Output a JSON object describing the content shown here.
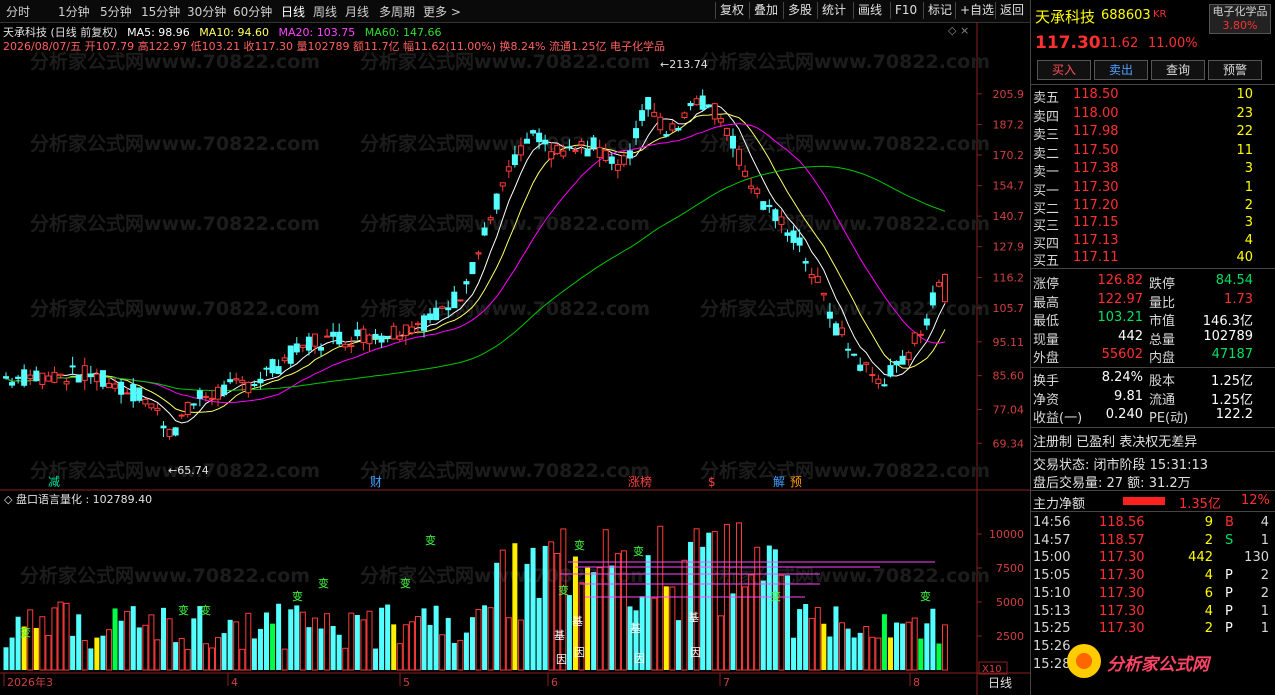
{
  "menu": {
    "periods": [
      "分时",
      "1分钟",
      "5分钟",
      "15分钟",
      "30分钟",
      "60分钟",
      "日线",
      "周线",
      "月线",
      "多周期",
      "更多 >"
    ],
    "tools": [
      "复权",
      "叠加",
      "多股",
      "统计",
      "画线",
      "F10",
      "标记",
      "+自选",
      "返回"
    ]
  },
  "chart_header": {
    "title": "天承科技 (日线 前复权)",
    "ma5": "MA5: 98.96",
    "ma10": "MA10: 94.60",
    "ma20": "MA20: 103.75",
    "ma60": "MA60: 147.66",
    "ohlc": "2026/08/07/五 开107.79 高122.97 低103.21 收117.30 量102789 额11.7亿 幅11.62(11.00%) 换8.24% 流通1.25亿 电子化学品"
  },
  "chart_data": {
    "type": "candlestick",
    "price_axis_ticks": [
      "205.9",
      "187.2",
      "170.2",
      "154.7",
      "140.7",
      "127.9",
      "116.2",
      "105.7",
      "95.11",
      "85.60",
      "77.04",
      "69.34"
    ],
    "volume_axis_ticks": [
      "10000",
      "7500",
      "5000",
      "2500"
    ],
    "volume_unit": "X10",
    "month_labels": [
      "2026年3",
      "4",
      "5",
      "6",
      "7",
      "8"
    ],
    "period_label": "日线",
    "high_label": "213.74",
    "low_label": "65.74",
    "events": [
      "减",
      "财",
      "涨榜",
      "$",
      "解",
      "预"
    ],
    "volume_indicator": "盘口语言量化 : 102789.40",
    "volume_marks": [
      "变",
      "基",
      "因"
    ],
    "watermark": "分析家公式网www.70822.com",
    "ylim": [
      65,
      215
    ],
    "vol_ylim": [
      0,
      12500
    ]
  },
  "colors": {
    "up": "#ff3b3b",
    "down": "#54ffff",
    "ma5": "#ffffff",
    "ma10": "#ffff66",
    "ma20": "#ff00ff",
    "ma60": "#00c800"
  },
  "quote": {
    "name": "天承科技",
    "code": "688603",
    "market": "KR",
    "sector": "电子化学品",
    "price": "117.30",
    "change": "11.62",
    "pct": "11.00%",
    "sector_pct": "3.80%",
    "buttons": [
      "买入",
      "卖出",
      "查询",
      "预警"
    ],
    "asks": [
      {
        "label": "卖五",
        "price": "118.50",
        "vol": "10"
      },
      {
        "label": "卖四",
        "price": "118.00",
        "vol": "23"
      },
      {
        "label": "卖三",
        "price": "117.98",
        "vol": "22"
      },
      {
        "label": "卖二",
        "price": "117.50",
        "vol": "11"
      },
      {
        "label": "卖一",
        "price": "117.38",
        "vol": "3"
      }
    ],
    "bids": [
      {
        "label": "买一",
        "price": "117.30",
        "vol": "1"
      },
      {
        "label": "买二",
        "price": "117.20",
        "vol": "2"
      },
      {
        "label": "买三",
        "price": "117.15",
        "vol": "3"
      },
      {
        "label": "买四",
        "price": "117.13",
        "vol": "4"
      },
      {
        "label": "买五",
        "price": "117.11",
        "vol": "40"
      }
    ],
    "stats": [
      {
        "l1": "涨停",
        "v1": "126.82",
        "l2": "跌停",
        "v2": "84.54"
      },
      {
        "l1": "最高",
        "v1": "122.97",
        "l2": "量比",
        "v2": "1.73"
      },
      {
        "l1": "最低",
        "v1": "103.21",
        "l2": "市值",
        "v2": "146.3亿"
      },
      {
        "l1": "现量",
        "v1": "442",
        "l2": "总量",
        "v2": "102789"
      },
      {
        "l1": "外盘",
        "v1": "55602",
        "l2": "内盘",
        "v2": "47187"
      }
    ],
    "fin": [
      {
        "l1": "换手",
        "v1": "8.24%",
        "l2": "股本",
        "v2": "1.25亿"
      },
      {
        "l1": "净资",
        "v1": "9.81",
        "l2": "流通",
        "v2": "1.25亿"
      },
      {
        "l1": "收益(一)",
        "v1": "0.240",
        "l2": "PE(动)",
        "v2": "122.2"
      }
    ],
    "note": "注册制 已盈利 表决权无差异",
    "status": "交易状态: 闭市阶段 15:31:13",
    "after": "盘后交易量: 27  额: 31.2万",
    "netflow_label": "主力净额",
    "netflow": "1.35亿",
    "netflow_pct": "12%",
    "ticks": [
      {
        "t": "14:56",
        "p": "118.56",
        "v": "9",
        "s": "B",
        "n": "4"
      },
      {
        "t": "14:57",
        "p": "118.57",
        "v": "2",
        "s": "S",
        "n": "1"
      },
      {
        "t": "15:00",
        "p": "117.30",
        "v": "442",
        "s": "",
        "n": "130"
      },
      {
        "t": "15:05",
        "p": "117.30",
        "v": "4",
        "s": "P",
        "n": "2"
      },
      {
        "t": "15:10",
        "p": "117.30",
        "v": "6",
        "s": "P",
        "n": "2"
      },
      {
        "t": "15:13",
        "p": "117.30",
        "v": "4",
        "s": "P",
        "n": "1"
      },
      {
        "t": "15:25",
        "p": "117.30",
        "v": "2",
        "s": "P",
        "n": "1"
      },
      {
        "t": "15:26",
        "p": "",
        "v": "",
        "s": "",
        "n": ""
      },
      {
        "t": "15:28",
        "p": "",
        "v": "",
        "s": "",
        "n": ""
      }
    ],
    "logo": "分析家公式网"
  }
}
